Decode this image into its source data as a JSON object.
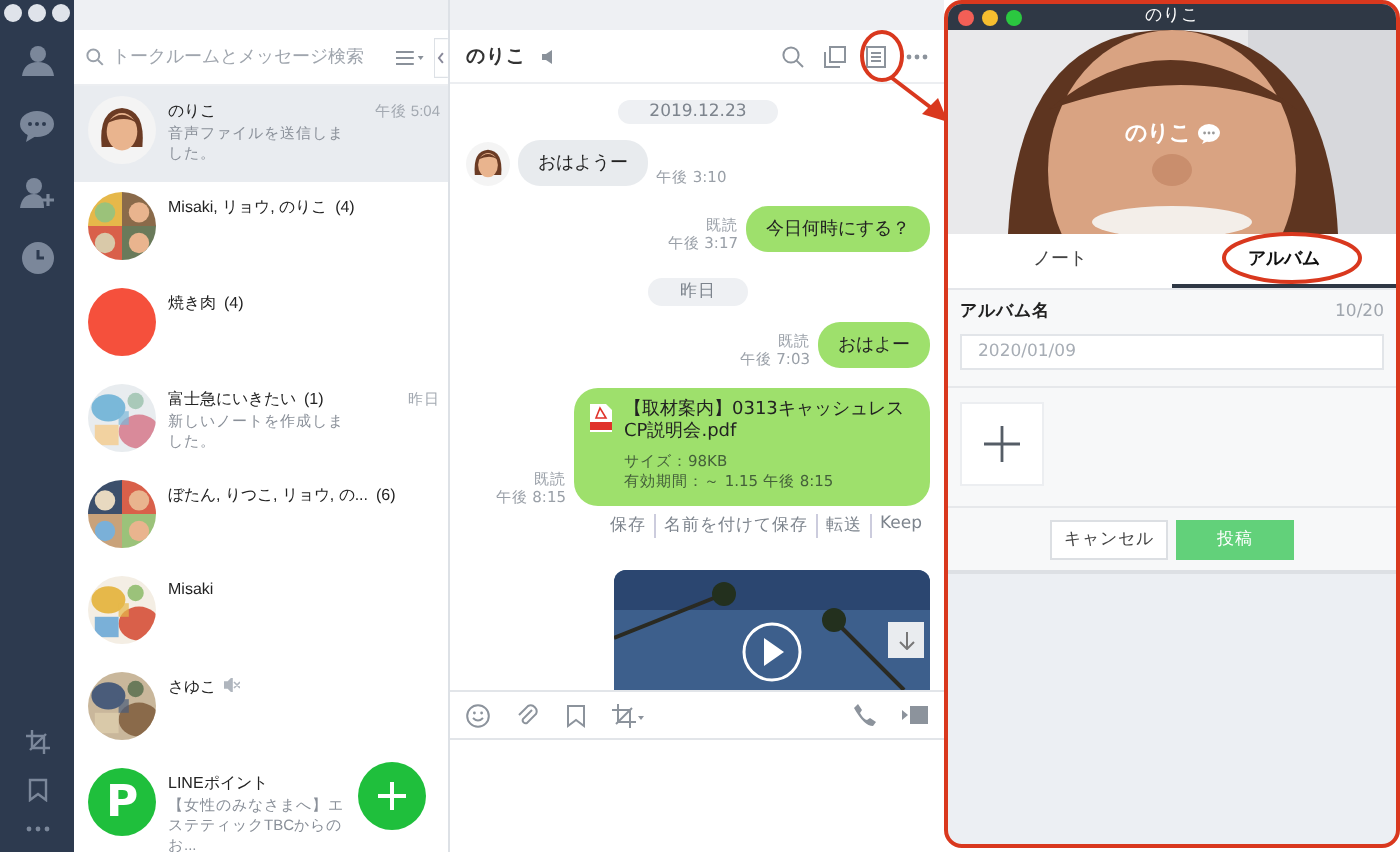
{
  "chat_list": {
    "search": {
      "placeholder": "トークルームとメッセージ検索"
    },
    "items": [
      {
        "name": "のりこ",
        "time": "午後 5:04",
        "preview": "音声ファイルを送信しました。",
        "selected": true,
        "muted": false,
        "avatar": {
          "kind": "person"
        }
      },
      {
        "name": "Misaki, リョウ, のりこ",
        "count": "(4)",
        "selected": false,
        "muted": false,
        "avatar": {
          "kind": "group"
        }
      },
      {
        "name": "焼き肉",
        "count": "(4)",
        "selected": false,
        "muted": false,
        "avatar": {
          "kind": "color",
          "color": "#f5503c"
        }
      },
      {
        "name": "富士急にいきたい",
        "count": "(1)",
        "time": "昨日",
        "preview": "新しいノートを作成しました。",
        "selected": false,
        "muted": false
      },
      {
        "name": "ぼたん, りつこ, リョウ, の...",
        "count": "(6)",
        "selected": false,
        "muted": false,
        "avatar": {
          "kind": "group"
        }
      },
      {
        "name": "Misaki",
        "selected": false,
        "muted": false
      },
      {
        "name": "さゆこ",
        "selected": false,
        "muted": true
      },
      {
        "name": "LINEポイント",
        "preview": "【女性のみなさまへ】エステティックTBCからのお...",
        "selected": false,
        "muted": false,
        "avatar": {
          "kind": "letter",
          "letter": "P",
          "color": "#1fbf3c"
        }
      }
    ]
  },
  "chat": {
    "title": "のりこ",
    "messages": [
      {
        "kind": "date",
        "text": "2019.12.23"
      },
      {
        "kind": "received",
        "text": "おはようー",
        "time": "午後 3:10"
      },
      {
        "kind": "sent",
        "text": "今日何時にする？",
        "read": "既読",
        "time": "午後 3:17"
      },
      {
        "kind": "date",
        "text": "昨日"
      },
      {
        "kind": "sent",
        "text": "おはよー",
        "read": "既読",
        "time": "午後 7:03"
      },
      {
        "kind": "file",
        "title": "【取材案内】0313キャッシュレスCP説明会.pdf",
        "size": "サイズ：98KB",
        "expiry": "有効期間：～ 1.15 午後 8:15",
        "read": "既読",
        "time": "午後 8:15",
        "actions": [
          "保存",
          "名前を付けて保存",
          "転送",
          "Keep"
        ]
      },
      {
        "kind": "video"
      }
    ]
  },
  "profile": {
    "title": "のりこ",
    "name": "のりこ",
    "tabs": [
      {
        "label": "ノート",
        "selected": false
      },
      {
        "label": "アルバム",
        "selected": true
      }
    ],
    "album": {
      "label": "アルバム名",
      "counter": "10/20",
      "placeholder": "2020/01/09"
    },
    "buttons": [
      {
        "label": "キャンセル",
        "kind": "secondary"
      },
      {
        "label": "投稿",
        "kind": "primary"
      }
    ]
  }
}
